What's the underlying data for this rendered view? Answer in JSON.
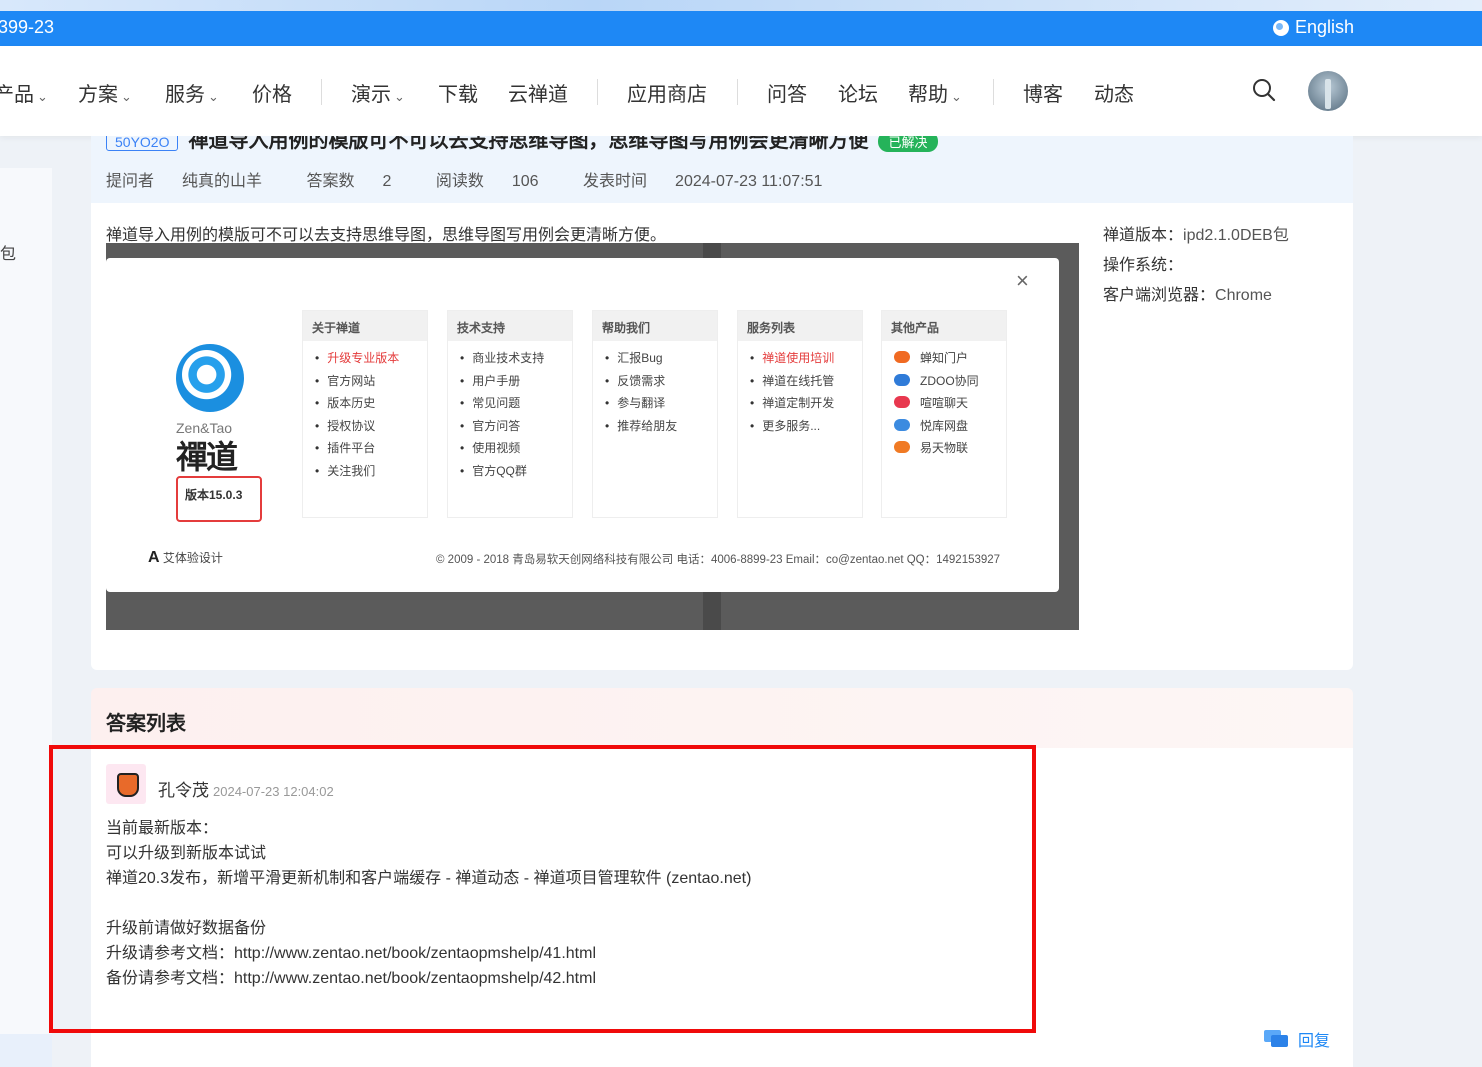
{
  "topbar": {
    "phone": "399-23",
    "lang": "English"
  },
  "nav": {
    "items": [
      {
        "label": "产品",
        "dropdown": true
      },
      {
        "label": "方案",
        "dropdown": true
      },
      {
        "label": "服务",
        "dropdown": true
      },
      {
        "label": "价格",
        "dropdown": false
      },
      {
        "label": "演示",
        "dropdown": true
      },
      {
        "label": "下载",
        "dropdown": false
      },
      {
        "label": "云禅道",
        "dropdown": false
      },
      {
        "label": "应用商店",
        "dropdown": false
      },
      {
        "label": "问答",
        "dropdown": false
      },
      {
        "label": "论坛",
        "dropdown": false
      },
      {
        "label": "帮助",
        "dropdown": true
      },
      {
        "label": "博客",
        "dropdown": false
      },
      {
        "label": "动态",
        "dropdown": false
      }
    ],
    "chevron": "⌄"
  },
  "leftpanel": {
    "fragment": "包"
  },
  "question": {
    "id_badge": "50YO2O",
    "title": "禅道导入用例的模版可不可以去支持思维导图，思维导图写用例会更清晰方便",
    "solved": "已解决",
    "meta": {
      "asker_label": "提问者",
      "asker": "纯真的山羊",
      "answers_label": "答案数",
      "answers": "2",
      "reads_label": "阅读数",
      "reads": "106",
      "time_label": "发表时间",
      "time": "2024-07-23 11:07:51"
    },
    "body": "禅道导入用例的模版可不可以去支持思维导图，思维导图写用例会更清晰方便。",
    "side": {
      "version_label": "禅道版本：",
      "version": "ipd2.1.0DEB包",
      "os_label": "操作系统：",
      "os": "",
      "browser_label": "客户端浏览器：",
      "browser": "Chrome"
    }
  },
  "dialog": {
    "close": "×",
    "logo_en": "Zen&Tao",
    "logo_cn": "禪道",
    "version": "版本15.0.3",
    "columns": [
      {
        "head": "关于禅道",
        "items": [
          "升级专业版本",
          "官方网站",
          "版本历史",
          "授权协议",
          "插件平台",
          "关注我们"
        ]
      },
      {
        "head": "技术支持",
        "items": [
          "商业技术支持",
          "用户手册",
          "常见问题",
          "官方问答",
          "使用视频",
          "官方QQ群"
        ]
      },
      {
        "head": "帮助我们",
        "items": [
          "汇报Bug",
          "反馈需求",
          "参与翻译",
          "推荐给朋友"
        ]
      },
      {
        "head": "服务列表",
        "items": [
          "禅道使用培训",
          "禅道在线托管",
          "禅道定制开发",
          "更多服务..."
        ]
      },
      {
        "head": "其他产品",
        "items": [
          "蝉知门户",
          "ZDOO协同",
          "喧喧聊天",
          "悦库网盘",
          "易天物联"
        ]
      }
    ],
    "product_colors": [
      "#f06a22",
      "#2f7bd8",
      "#e8384f",
      "#3c8be0",
      "#f07a24"
    ],
    "footer_left": "艾体验设计",
    "footer_left_mark": "A",
    "footer": "© 2009 - 2018 青岛易软天创网络科技有限公司 电话：4006-8899-23 Email：co@zentao.net QQ：1492153927"
  },
  "answers": {
    "heading": "答案列表",
    "items": [
      {
        "user": "孔令茂",
        "time": "2024-07-23 12:04:02",
        "lines": [
          "当前最新版本：",
          "可以升级到新版本试试",
          "禅道20.3发布，新增平滑更新机制和客户端缓存 - 禅道动态 - 禅道项目管理软件 (zentao.net)",
          "",
          "升级前请做好数据备份",
          "升级请参考文档：http://www.zentao.net/book/zentaopmshelp/41.html",
          "备份请参考文档：http://www.zentao.net/book/zentaopmshelp/42.html"
        ],
        "reply": "回复"
      }
    ]
  },
  "colors": {
    "brand": "#1e88f5",
    "highlight": "#f00a0a",
    "solved": "#25b35a"
  }
}
